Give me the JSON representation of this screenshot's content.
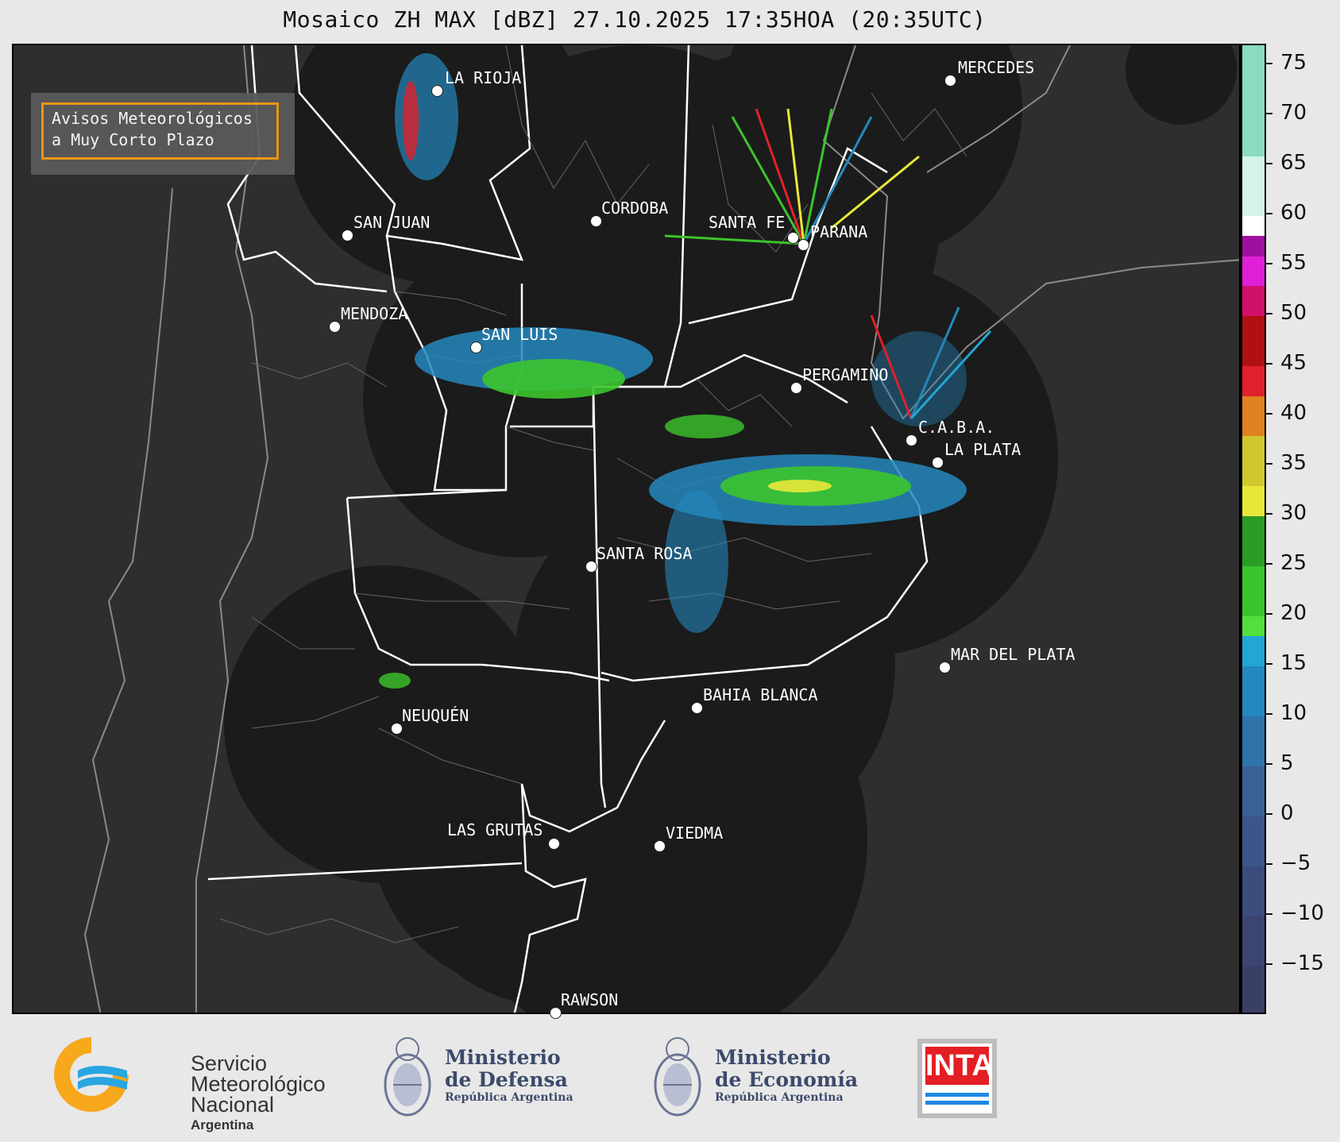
{
  "title": "Mosaico ZH MAX [dBZ] 27.10.2025 17:35HOA (20:35UTC)",
  "notice": {
    "line1": "Avisos Meteorológicos",
    "line2": "a Muy Corto Plazo"
  },
  "cities": [
    {
      "id": "la-rioja",
      "name": "LA RIOJA"
    },
    {
      "id": "mercedes",
      "name": "MERCEDES"
    },
    {
      "id": "san-juan",
      "name": "SAN JUAN"
    },
    {
      "id": "cordoba",
      "name": "CORDOBA"
    },
    {
      "id": "santa-fe",
      "name": "SANTA FE"
    },
    {
      "id": "parana",
      "name": "PARANA"
    },
    {
      "id": "mendoza",
      "name": "MENDOZA"
    },
    {
      "id": "san-luis",
      "name": "SAN LUIS"
    },
    {
      "id": "pergamino",
      "name": "PERGAMINO"
    },
    {
      "id": "caba",
      "name": "C.A.B.A."
    },
    {
      "id": "la-plata",
      "name": "LA PLATA"
    },
    {
      "id": "santa-rosa",
      "name": "SANTA ROSA"
    },
    {
      "id": "mar-del-plata",
      "name": "MAR DEL PLATA"
    },
    {
      "id": "bahia-blanca",
      "name": "BAHIA BLANCA"
    },
    {
      "id": "neuquen",
      "name": "NEUQUÉN"
    },
    {
      "id": "las-grutas",
      "name": "LAS GRUTAS"
    },
    {
      "id": "viedma",
      "name": "VIEDMA"
    },
    {
      "id": "rawson",
      "name": "RAWSON"
    }
  ],
  "colorbar": {
    "unit": "dBZ",
    "min": -20,
    "max": 77,
    "ticks": [
      "75",
      "70",
      "65",
      "60",
      "55",
      "50",
      "45",
      "40",
      "35",
      "30",
      "25",
      "20",
      "15",
      "10",
      "5",
      "0",
      "−5",
      "−10",
      "−15"
    ],
    "bands": [
      {
        "from": -20,
        "to": -15,
        "color": "#3a3f66"
      },
      {
        "from": -15,
        "to": -10,
        "color": "#3b4571"
      },
      {
        "from": -10,
        "to": -5,
        "color": "#3c4c7d"
      },
      {
        "from": -5,
        "to": 0,
        "color": "#3d5588"
      },
      {
        "from": 0,
        "to": 5,
        "color": "#3a6195"
      },
      {
        "from": 5,
        "to": 10,
        "color": "#2f73ab"
      },
      {
        "from": 10,
        "to": 15,
        "color": "#2487bd"
      },
      {
        "from": 15,
        "to": 18,
        "color": "#22a6d6"
      },
      {
        "from": 18,
        "to": 20,
        "color": "#52e03c"
      },
      {
        "from": 20,
        "to": 25,
        "color": "#3cc42c"
      },
      {
        "from": 25,
        "to": 30,
        "color": "#2a9c24"
      },
      {
        "from": 30,
        "to": 33,
        "color": "#e8e83a"
      },
      {
        "from": 33,
        "to": 38,
        "color": "#cfc82d"
      },
      {
        "from": 38,
        "to": 42,
        "color": "#e0821f"
      },
      {
        "from": 42,
        "to": 45,
        "color": "#e0202a"
      },
      {
        "from": 45,
        "to": 50,
        "color": "#b01010"
      },
      {
        "from": 50,
        "to": 53,
        "color": "#d0106a"
      },
      {
        "from": 53,
        "to": 56,
        "color": "#e020d8"
      },
      {
        "from": 56,
        "to": 58,
        "color": "#a010a0"
      },
      {
        "from": 58,
        "to": 60,
        "color": "#ffffff"
      },
      {
        "from": 60,
        "to": 66,
        "color": "#d4f4e8"
      },
      {
        "from": 66,
        "to": 77,
        "color": "#8adcbe"
      }
    ]
  },
  "logos": {
    "smn_line1": "Servicio",
    "smn_line2": "Meteorológico",
    "smn_line3": "Nacional",
    "smn_country": "Argentina",
    "defensa_line1": "Ministerio",
    "defensa_line2": "de Defensa",
    "defensa_sub": "República Argentina",
    "economia_line1": "Ministerio",
    "economia_line2": "de Economía",
    "economia_sub": "República Argentina",
    "inta": "INTA"
  },
  "colors": {
    "map_background": "#2e2e2e",
    "radar_coverage": "#1b1b1b",
    "notice_border": "#f39c12"
  }
}
